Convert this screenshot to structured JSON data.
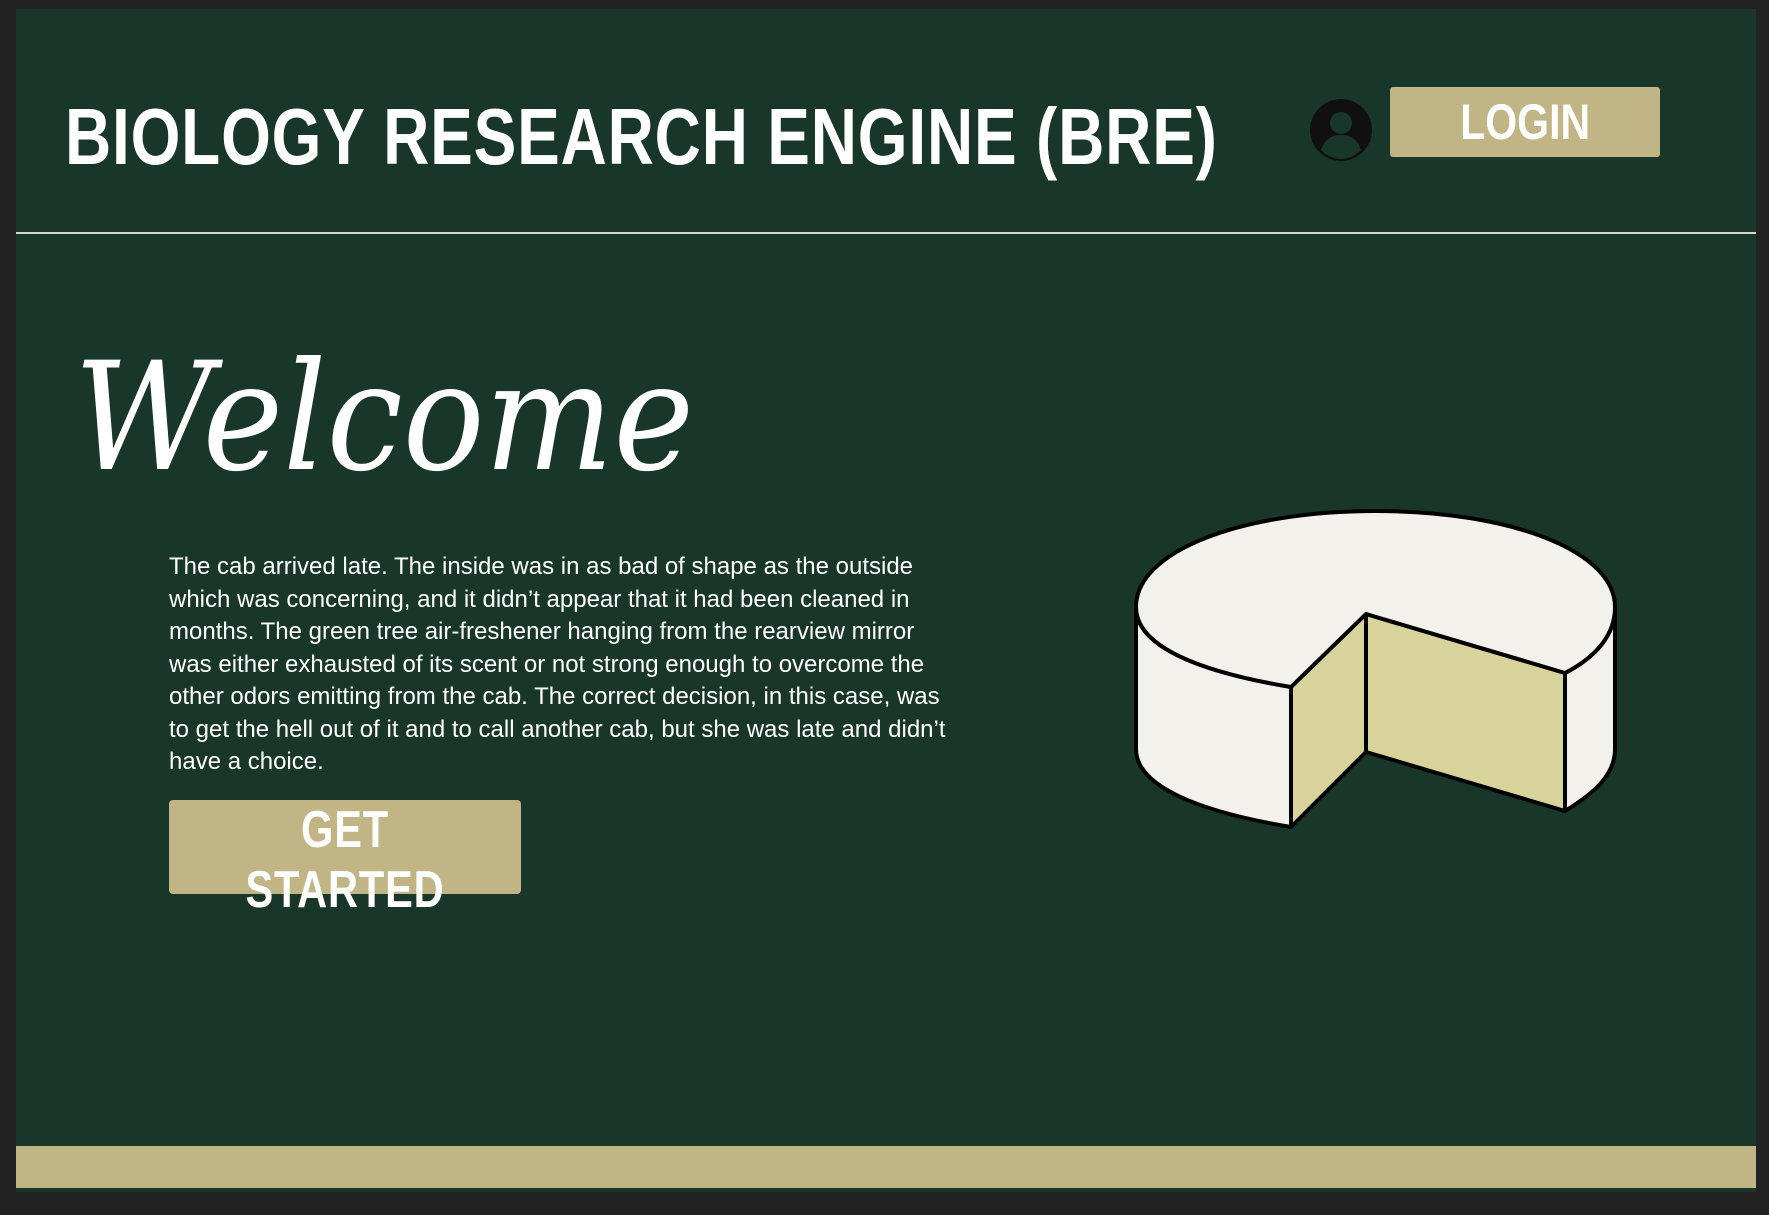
{
  "header": {
    "title": "BIOLOGY RESEARCH ENGINE (BRE)",
    "avatar_icon": "user-avatar-icon",
    "login_label": "LOGIN"
  },
  "hero": {
    "heading": "Welcome",
    "body": "The cab arrived late. The inside was in as bad of shape as the outside which was concerning, and it didn’t appear that it had been cleaned in months. The green tree air-freshener hanging from the rearview mirror was either exhausted of its scent or not strong enough to overcome the other odors emitting from the cab. The correct decision, in this case, was to get the hell out of it and to call another cab, but she was late and didn’t have a choice.",
    "cta_label": "GET STARTED",
    "illustration": "cheese-wheel-illustration"
  },
  "colors": {
    "background": "#18372a",
    "accent": "#c2b585",
    "text": "#ffffff",
    "cheese_rind": "#f2f1ec",
    "cheese_inside": "#d8d39a"
  }
}
